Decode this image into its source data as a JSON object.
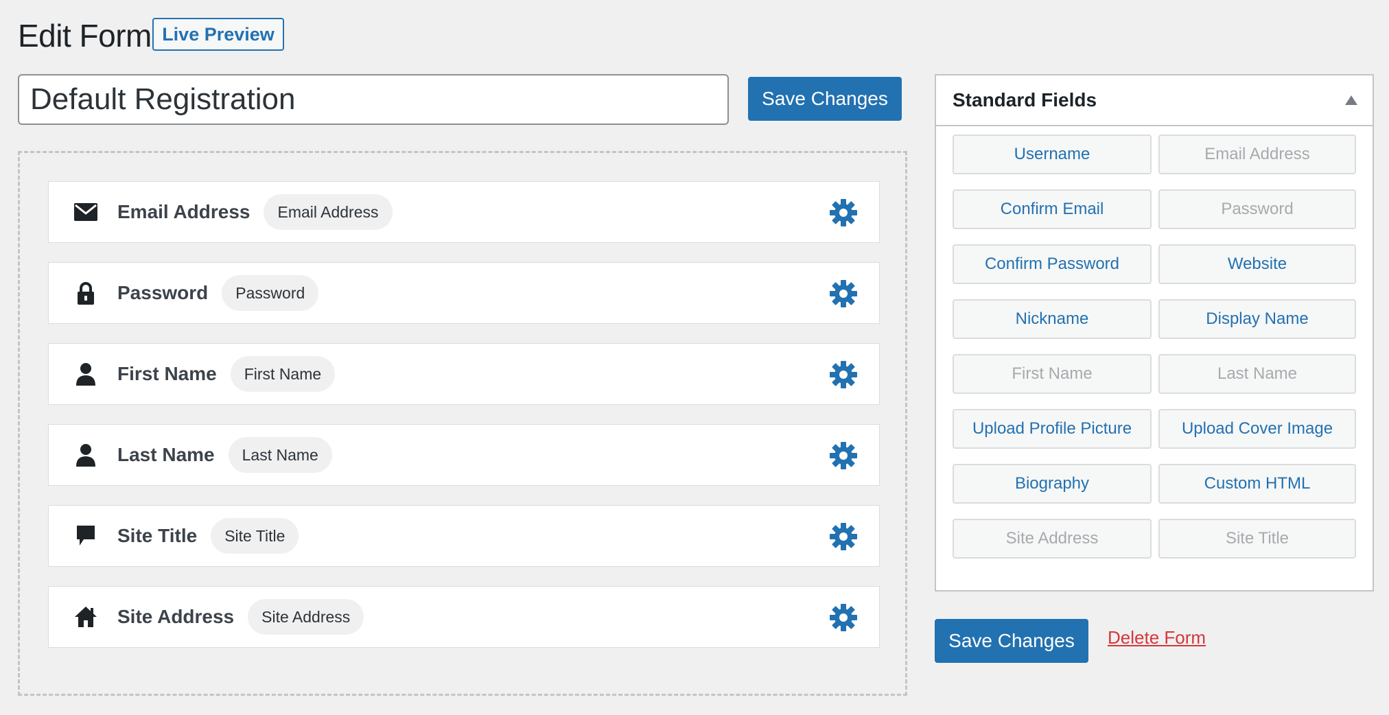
{
  "header": {
    "title": "Edit Form",
    "live_preview_label": "Live Preview"
  },
  "form": {
    "name_value": "Default Registration",
    "save_label": "Save Changes"
  },
  "fields": [
    {
      "label": "Email Address",
      "tag": "Email Address",
      "icon": "envelope-icon"
    },
    {
      "label": "Password",
      "tag": "Password",
      "icon": "lock-icon"
    },
    {
      "label": "First Name",
      "tag": "First Name",
      "icon": "user-icon"
    },
    {
      "label": "Last Name",
      "tag": "Last Name",
      "icon": "user-icon"
    },
    {
      "label": "Site Title",
      "tag": "Site Title",
      "icon": "speech-bubble-icon"
    },
    {
      "label": "Site Address",
      "tag": "Site Address",
      "icon": "home-icon"
    }
  ],
  "standard_fields": {
    "title": "Standard Fields",
    "buttons": [
      {
        "label": "Username",
        "enabled": true
      },
      {
        "label": "Email Address",
        "enabled": false
      },
      {
        "label": "Confirm Email",
        "enabled": true
      },
      {
        "label": "Password",
        "enabled": false
      },
      {
        "label": "Confirm Password",
        "enabled": true
      },
      {
        "label": "Website",
        "enabled": true
      },
      {
        "label": "Nickname",
        "enabled": true
      },
      {
        "label": "Display Name",
        "enabled": true
      },
      {
        "label": "First Name",
        "enabled": false
      },
      {
        "label": "Last Name",
        "enabled": false
      },
      {
        "label": "Upload Profile Picture",
        "enabled": true
      },
      {
        "label": "Upload Cover Image",
        "enabled": true
      },
      {
        "label": "Biography",
        "enabled": true
      },
      {
        "label": "Custom HTML",
        "enabled": true
      },
      {
        "label": "Site Address",
        "enabled": false
      },
      {
        "label": "Site Title",
        "enabled": false
      }
    ]
  },
  "footer": {
    "save_label": "Save Changes",
    "delete_label": "Delete Form"
  },
  "colors": {
    "accent": "#2271b1",
    "danger": "#d63638",
    "disabled_text": "#a7aaad",
    "background": "#f0f0f1"
  }
}
